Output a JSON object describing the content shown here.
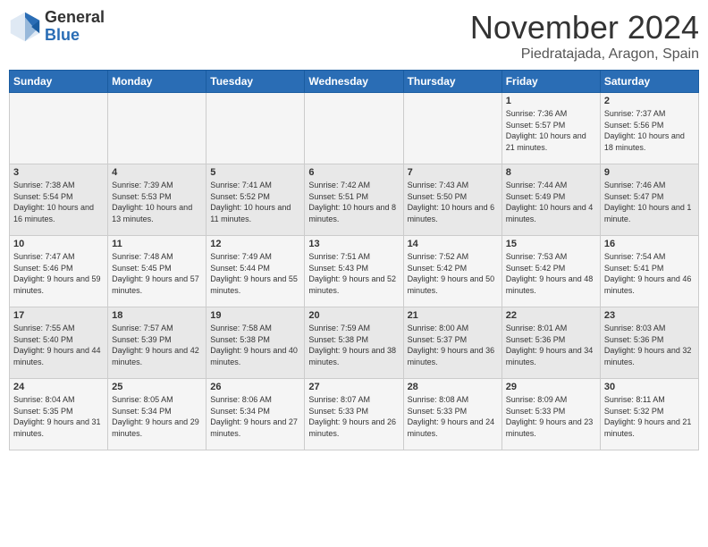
{
  "header": {
    "logo_line1": "General",
    "logo_line2": "Blue",
    "month": "November 2024",
    "location": "Piedratajada, Aragon, Spain"
  },
  "days_of_week": [
    "Sunday",
    "Monday",
    "Tuesday",
    "Wednesday",
    "Thursday",
    "Friday",
    "Saturday"
  ],
  "weeks": [
    [
      {
        "day": "",
        "sunrise": "",
        "sunset": "",
        "daylight": ""
      },
      {
        "day": "",
        "sunrise": "",
        "sunset": "",
        "daylight": ""
      },
      {
        "day": "",
        "sunrise": "",
        "sunset": "",
        "daylight": ""
      },
      {
        "day": "",
        "sunrise": "",
        "sunset": "",
        "daylight": ""
      },
      {
        "day": "",
        "sunrise": "",
        "sunset": "",
        "daylight": ""
      },
      {
        "day": "1",
        "sunrise": "Sunrise: 7:36 AM",
        "sunset": "Sunset: 5:57 PM",
        "daylight": "Daylight: 10 hours and 21 minutes."
      },
      {
        "day": "2",
        "sunrise": "Sunrise: 7:37 AM",
        "sunset": "Sunset: 5:56 PM",
        "daylight": "Daylight: 10 hours and 18 minutes."
      }
    ],
    [
      {
        "day": "3",
        "sunrise": "Sunrise: 7:38 AM",
        "sunset": "Sunset: 5:54 PM",
        "daylight": "Daylight: 10 hours and 16 minutes."
      },
      {
        "day": "4",
        "sunrise": "Sunrise: 7:39 AM",
        "sunset": "Sunset: 5:53 PM",
        "daylight": "Daylight: 10 hours and 13 minutes."
      },
      {
        "day": "5",
        "sunrise": "Sunrise: 7:41 AM",
        "sunset": "Sunset: 5:52 PM",
        "daylight": "Daylight: 10 hours and 11 minutes."
      },
      {
        "day": "6",
        "sunrise": "Sunrise: 7:42 AM",
        "sunset": "Sunset: 5:51 PM",
        "daylight": "Daylight: 10 hours and 8 minutes."
      },
      {
        "day": "7",
        "sunrise": "Sunrise: 7:43 AM",
        "sunset": "Sunset: 5:50 PM",
        "daylight": "Daylight: 10 hours and 6 minutes."
      },
      {
        "day": "8",
        "sunrise": "Sunrise: 7:44 AM",
        "sunset": "Sunset: 5:49 PM",
        "daylight": "Daylight: 10 hours and 4 minutes."
      },
      {
        "day": "9",
        "sunrise": "Sunrise: 7:46 AM",
        "sunset": "Sunset: 5:47 PM",
        "daylight": "Daylight: 10 hours and 1 minute."
      }
    ],
    [
      {
        "day": "10",
        "sunrise": "Sunrise: 7:47 AM",
        "sunset": "Sunset: 5:46 PM",
        "daylight": "Daylight: 9 hours and 59 minutes."
      },
      {
        "day": "11",
        "sunrise": "Sunrise: 7:48 AM",
        "sunset": "Sunset: 5:45 PM",
        "daylight": "Daylight: 9 hours and 57 minutes."
      },
      {
        "day": "12",
        "sunrise": "Sunrise: 7:49 AM",
        "sunset": "Sunset: 5:44 PM",
        "daylight": "Daylight: 9 hours and 55 minutes."
      },
      {
        "day": "13",
        "sunrise": "Sunrise: 7:51 AM",
        "sunset": "Sunset: 5:43 PM",
        "daylight": "Daylight: 9 hours and 52 minutes."
      },
      {
        "day": "14",
        "sunrise": "Sunrise: 7:52 AM",
        "sunset": "Sunset: 5:42 PM",
        "daylight": "Daylight: 9 hours and 50 minutes."
      },
      {
        "day": "15",
        "sunrise": "Sunrise: 7:53 AM",
        "sunset": "Sunset: 5:42 PM",
        "daylight": "Daylight: 9 hours and 48 minutes."
      },
      {
        "day": "16",
        "sunrise": "Sunrise: 7:54 AM",
        "sunset": "Sunset: 5:41 PM",
        "daylight": "Daylight: 9 hours and 46 minutes."
      }
    ],
    [
      {
        "day": "17",
        "sunrise": "Sunrise: 7:55 AM",
        "sunset": "Sunset: 5:40 PM",
        "daylight": "Daylight: 9 hours and 44 minutes."
      },
      {
        "day": "18",
        "sunrise": "Sunrise: 7:57 AM",
        "sunset": "Sunset: 5:39 PM",
        "daylight": "Daylight: 9 hours and 42 minutes."
      },
      {
        "day": "19",
        "sunrise": "Sunrise: 7:58 AM",
        "sunset": "Sunset: 5:38 PM",
        "daylight": "Daylight: 9 hours and 40 minutes."
      },
      {
        "day": "20",
        "sunrise": "Sunrise: 7:59 AM",
        "sunset": "Sunset: 5:38 PM",
        "daylight": "Daylight: 9 hours and 38 minutes."
      },
      {
        "day": "21",
        "sunrise": "Sunrise: 8:00 AM",
        "sunset": "Sunset: 5:37 PM",
        "daylight": "Daylight: 9 hours and 36 minutes."
      },
      {
        "day": "22",
        "sunrise": "Sunrise: 8:01 AM",
        "sunset": "Sunset: 5:36 PM",
        "daylight": "Daylight: 9 hours and 34 minutes."
      },
      {
        "day": "23",
        "sunrise": "Sunrise: 8:03 AM",
        "sunset": "Sunset: 5:36 PM",
        "daylight": "Daylight: 9 hours and 32 minutes."
      }
    ],
    [
      {
        "day": "24",
        "sunrise": "Sunrise: 8:04 AM",
        "sunset": "Sunset: 5:35 PM",
        "daylight": "Daylight: 9 hours and 31 minutes."
      },
      {
        "day": "25",
        "sunrise": "Sunrise: 8:05 AM",
        "sunset": "Sunset: 5:34 PM",
        "daylight": "Daylight: 9 hours and 29 minutes."
      },
      {
        "day": "26",
        "sunrise": "Sunrise: 8:06 AM",
        "sunset": "Sunset: 5:34 PM",
        "daylight": "Daylight: 9 hours and 27 minutes."
      },
      {
        "day": "27",
        "sunrise": "Sunrise: 8:07 AM",
        "sunset": "Sunset: 5:33 PM",
        "daylight": "Daylight: 9 hours and 26 minutes."
      },
      {
        "day": "28",
        "sunrise": "Sunrise: 8:08 AM",
        "sunset": "Sunset: 5:33 PM",
        "daylight": "Daylight: 9 hours and 24 minutes."
      },
      {
        "day": "29",
        "sunrise": "Sunrise: 8:09 AM",
        "sunset": "Sunset: 5:33 PM",
        "daylight": "Daylight: 9 hours and 23 minutes."
      },
      {
        "day": "30",
        "sunrise": "Sunrise: 8:11 AM",
        "sunset": "Sunset: 5:32 PM",
        "daylight": "Daylight: 9 hours and 21 minutes."
      }
    ]
  ]
}
